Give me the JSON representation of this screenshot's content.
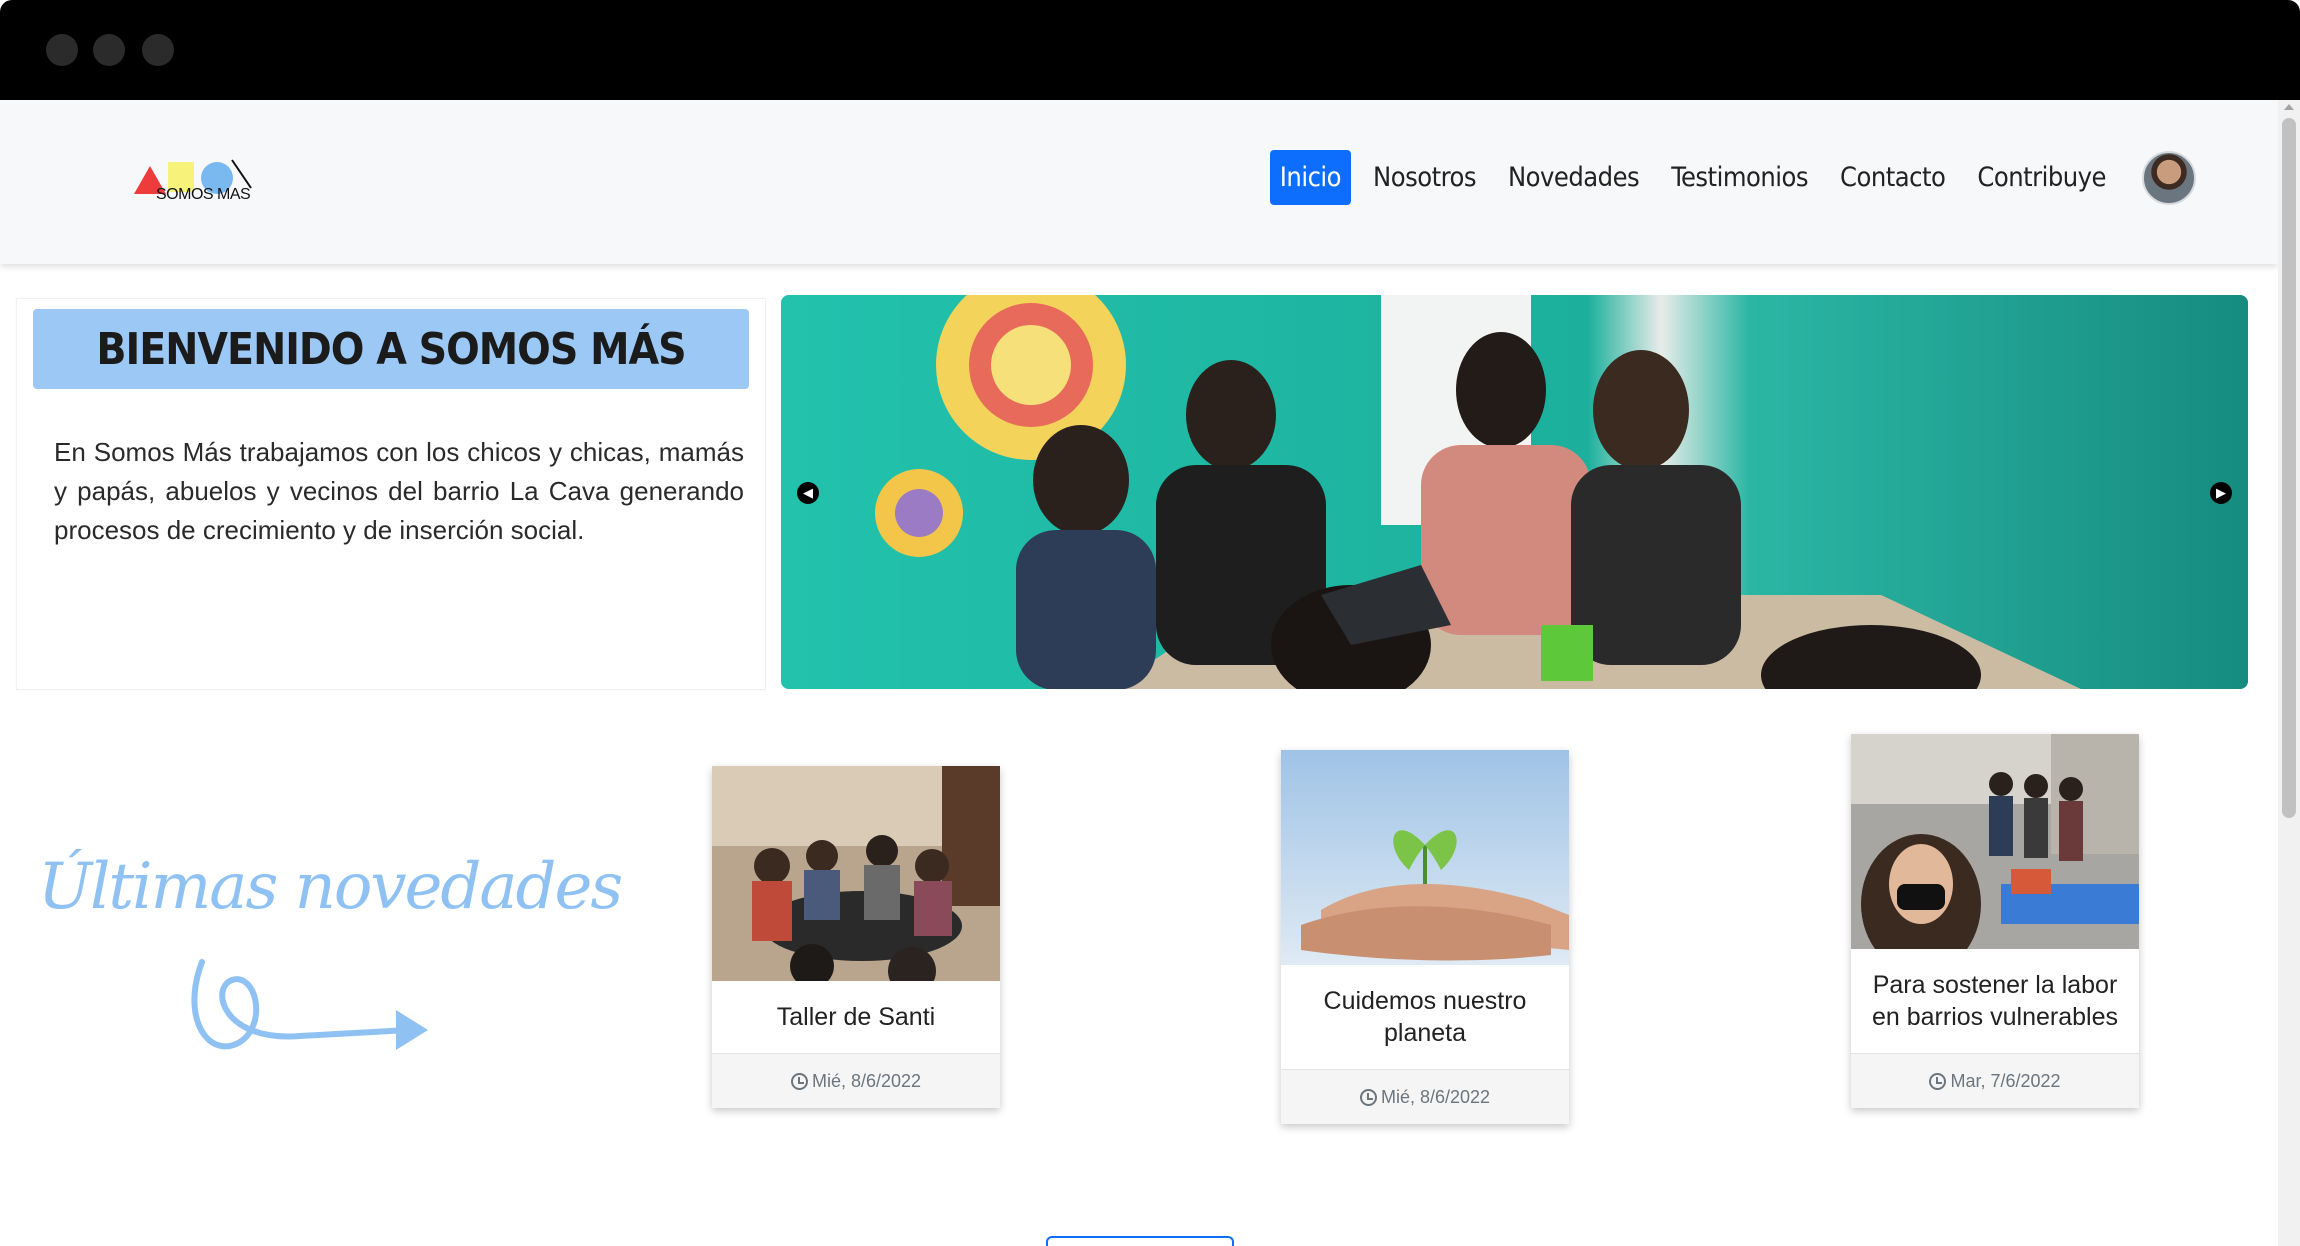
{
  "window": {
    "controls": [
      "close",
      "minimize",
      "maximize"
    ]
  },
  "brand": {
    "logo_text": "SOMOS MAS"
  },
  "nav": {
    "items": [
      {
        "label": "Inicio",
        "active": true
      },
      {
        "label": "Nosotros",
        "active": false
      },
      {
        "label": "Novedades",
        "active": false
      },
      {
        "label": "Testimonios",
        "active": false
      },
      {
        "label": "Contacto",
        "active": false
      },
      {
        "label": "Contribuye",
        "active": false
      }
    ],
    "avatar_icon": "user-avatar"
  },
  "hero": {
    "title": "BIENVENIDO A SOMOS MÁS",
    "text": "En Somos Más trabajamos con los chicos y chicas, mamás y papás, abuelos y vecinos del barrio La Cava generando procesos de crecimiento y de inserción social.",
    "carousel": {
      "prev_icon": "arrow-left-circle",
      "next_icon": "arrow-right-circle"
    }
  },
  "news": {
    "heading": "Últimas novedades",
    "cards": [
      {
        "title": "Taller de Santi",
        "date": "Mié, 8/6/2022"
      },
      {
        "title": "Cuidemos nuestro planeta",
        "date": "Mié, 8/6/2022"
      },
      {
        "title": "Para sostener la labor en barrios vulnerables",
        "date": "Mar, 7/6/2022"
      }
    ]
  },
  "colors": {
    "accent": "#0d6efd",
    "hero_title_bg": "#9cc8f6",
    "heading": "#8fc2f3"
  }
}
